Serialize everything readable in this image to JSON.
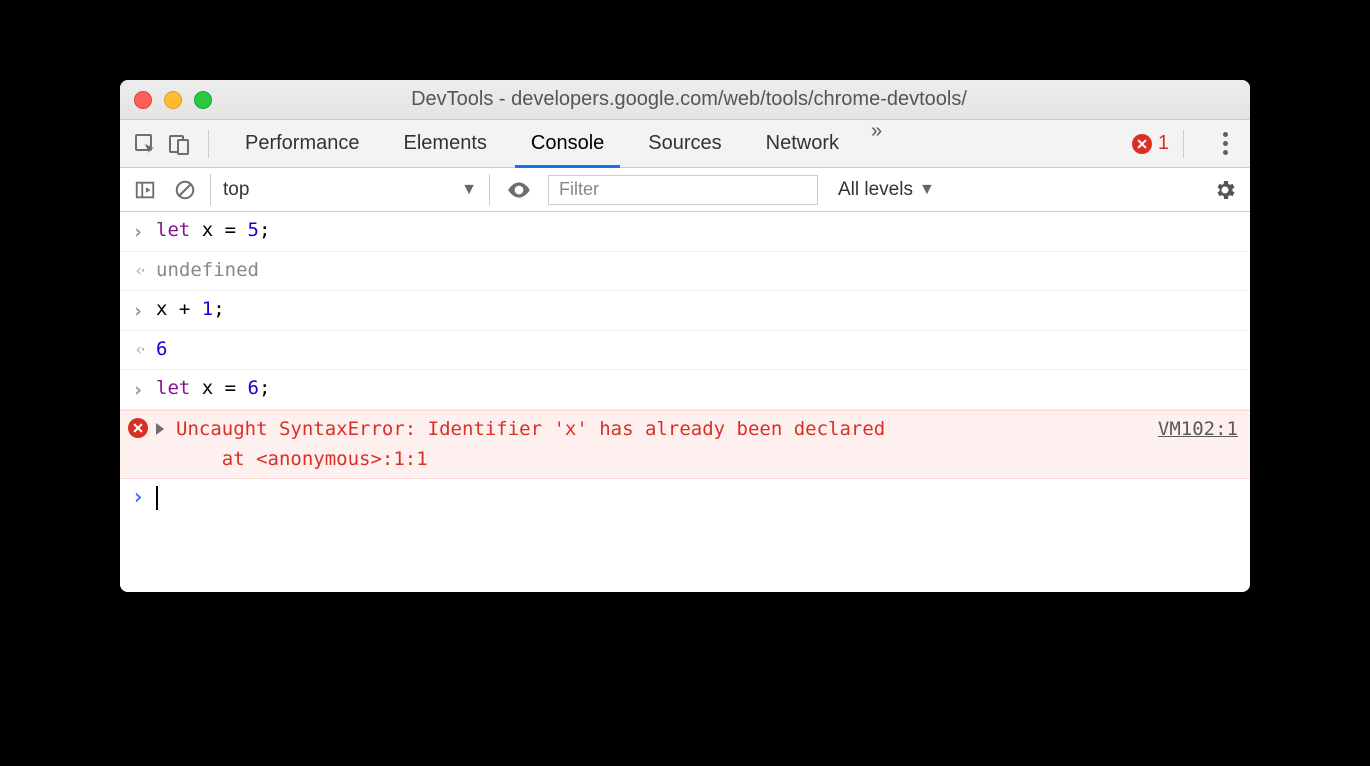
{
  "window": {
    "title": "DevTools - developers.google.com/web/tools/chrome-devtools/"
  },
  "tabs": {
    "items": [
      "Performance",
      "Elements",
      "Console",
      "Sources",
      "Network"
    ],
    "active_index": 2,
    "overflow_glyph": "»",
    "error_count": "1"
  },
  "toolbar": {
    "context_label": "top",
    "filter_placeholder": "Filter",
    "levels_label": "All levels"
  },
  "console": {
    "entries": [
      {
        "type": "input",
        "tokens": [
          [
            "kw",
            "let"
          ],
          [
            "txt",
            " x = "
          ],
          [
            "num",
            "5"
          ],
          [
            "txt",
            ";"
          ]
        ]
      },
      {
        "type": "result",
        "tokens": [
          [
            "muted",
            "undefined"
          ]
        ]
      },
      {
        "type": "input",
        "tokens": [
          [
            "txt",
            "x + "
          ],
          [
            "num",
            "1"
          ],
          [
            "txt",
            ";"
          ]
        ]
      },
      {
        "type": "result",
        "tokens": [
          [
            "num",
            "6"
          ]
        ]
      },
      {
        "type": "input",
        "tokens": [
          [
            "kw",
            "let"
          ],
          [
            "txt",
            " x = "
          ],
          [
            "num",
            "6"
          ],
          [
            "txt",
            ";"
          ]
        ]
      }
    ],
    "error": {
      "message_line1": "Uncaught SyntaxError: Identifier 'x' has already been declared",
      "message_line2": "    at <anonymous>:1:1",
      "source_link": "VM102:1"
    }
  }
}
